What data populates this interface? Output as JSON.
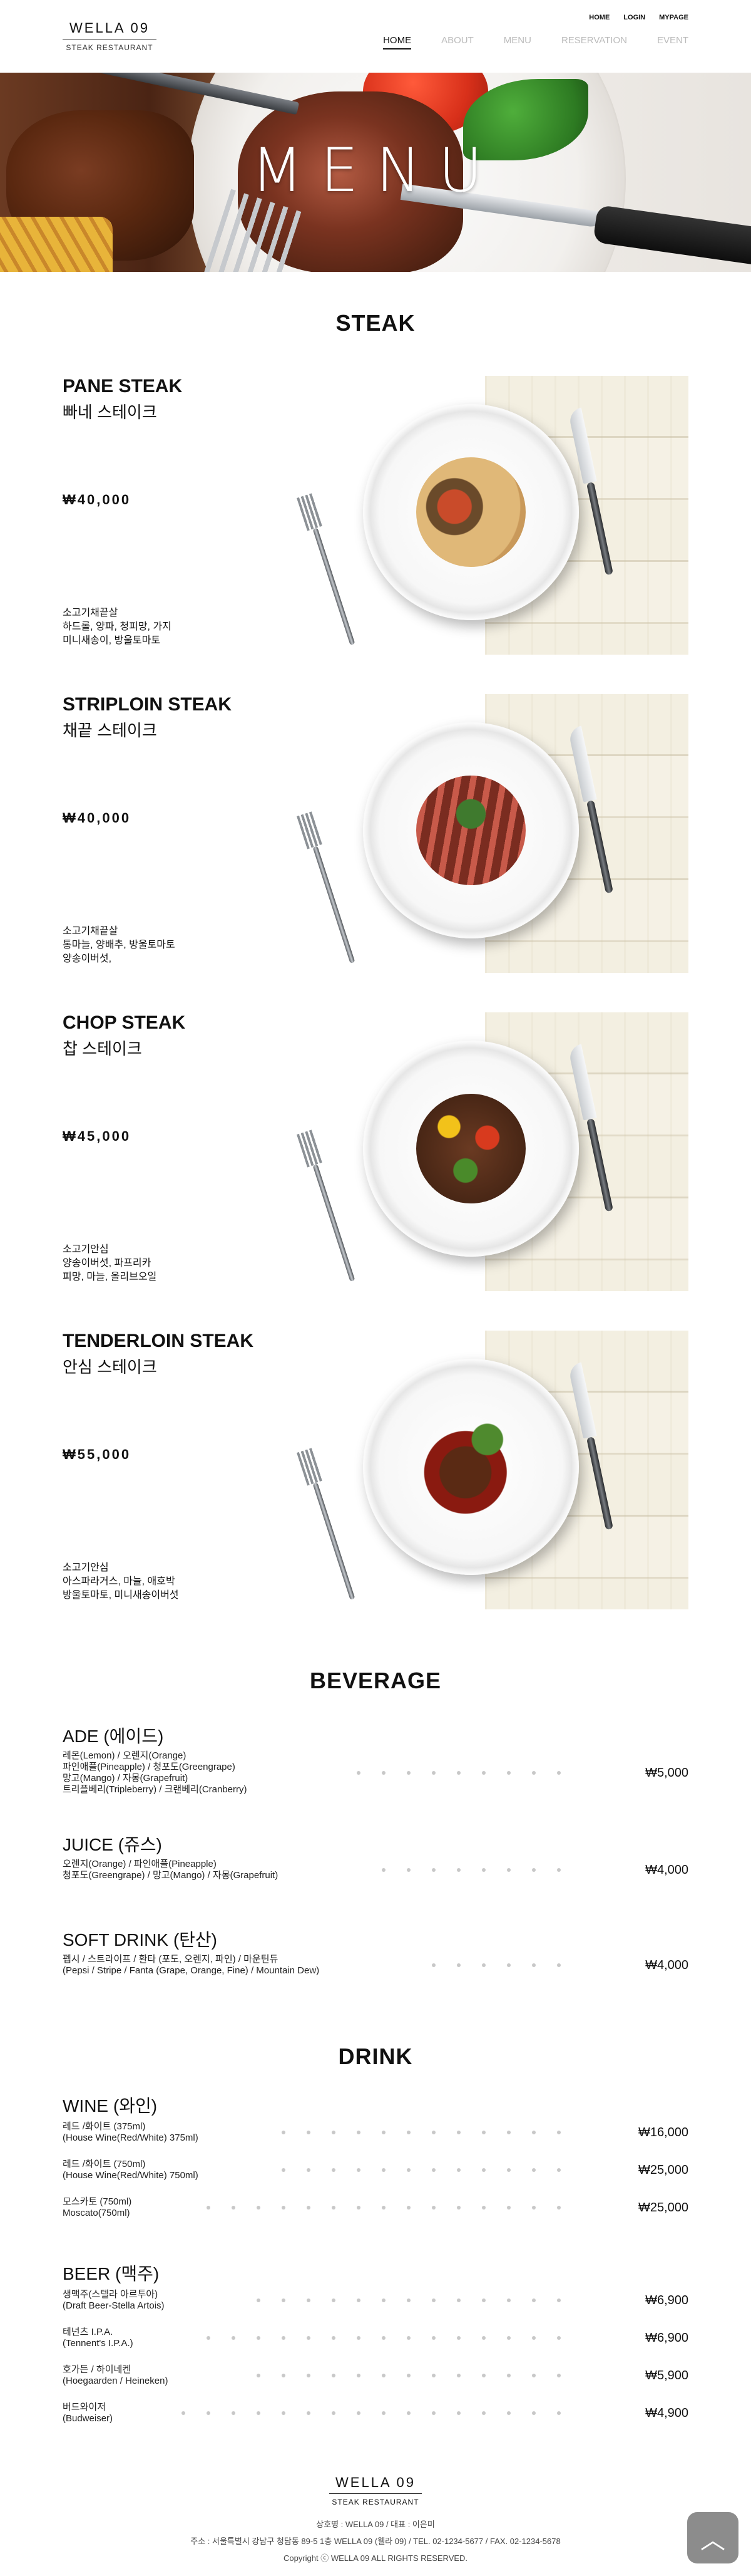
{
  "header": {
    "logo_name": "WELLA 09",
    "logo_sub": "STEAK RESTAURANT",
    "util": [
      "HOME",
      "LOGIN",
      "MYPAGE"
    ],
    "nav": [
      "HOME",
      "ABOUT",
      "MENU",
      "RESERVATION",
      "EVENT"
    ],
    "active_nav": "HOME"
  },
  "hero": {
    "title": "MENU"
  },
  "steak_section": {
    "title": "STEAK",
    "items": [
      {
        "name_en": "PANE STEAK",
        "name_ko": "빠네 스테이크",
        "price": "₩40,000",
        "desc": [
          "소고기채끝살",
          "하드롤, 양파, 청피망, 가지",
          "미니새송이, 방울토마토"
        ]
      },
      {
        "name_en": "STRIPLOIN STEAK",
        "name_ko": "채끝 스테이크",
        "price": "₩40,000",
        "desc": [
          "소고기채끝살",
          "통마늘, 양배추, 방울토마토",
          "양송이버섯,"
        ]
      },
      {
        "name_en": "CHOP STEAK",
        "name_ko": "찹 스테이크",
        "price": "₩45,000",
        "desc": [
          "소고기안심",
          "양송이버섯, 파프리카",
          "피망, 마늘, 올리브오일"
        ]
      },
      {
        "name_en": "TENDERLOIN STEAK",
        "name_ko": "안심 스테이크",
        "price": "₩55,000",
        "desc": [
          "소고기안심",
          "아스파라거스, 마늘, 애호박",
          "방울토마토, 미니새송이버섯"
        ]
      }
    ]
  },
  "beverage_section": {
    "title": "BEVERAGE",
    "groups": [
      {
        "title": "ADE (에이드)",
        "rows": [
          {
            "lines": [
              "레몬(Lemon) / 오렌지(Orange)",
              "파인애플(Pineapple) / 청포도(Greengrape)",
              "망고(Mango) / 자몽(Grapefruit)",
              "트리플베리(Tripleberry) / 크랜베리(Cranberry)"
            ],
            "price": "₩5,000"
          }
        ]
      },
      {
        "title": "JUICE (쥬스)",
        "rows": [
          {
            "lines": [
              "오렌지(Orange) / 파인애플(Pineapple)",
              "청포도(Greengrape) / 망고(Mango) / 자몽(Grapefruit)"
            ],
            "price": "₩4,000"
          }
        ]
      },
      {
        "title": "SOFT DRINK (탄산)",
        "rows": [
          {
            "lines": [
              "펩시 / 스트라이프 / 환타 (포도, 오렌지, 파인) / 마운틴듀",
              "(Pepsi / Stripe / Fanta (Grape, Orange, Fine) / Mountain Dew)"
            ],
            "price": "₩4,000"
          }
        ]
      }
    ]
  },
  "drink_section": {
    "title": "DRINK",
    "groups": [
      {
        "title": "WINE (와인)",
        "rows": [
          {
            "lines": [
              "레드 /화이트 (375ml)",
              "(House Wine(Red/White) 375ml)"
            ],
            "price": "₩16,000"
          },
          {
            "lines": [
              "레드 /화이트 (750ml)",
              "(House Wine(Red/White) 750ml)"
            ],
            "price": "₩25,000"
          },
          {
            "lines": [
              "모스카토 (750ml)",
              "Moscato(750ml)"
            ],
            "price": "₩25,000"
          }
        ]
      },
      {
        "title": "BEER (맥주)",
        "rows": [
          {
            "lines": [
              "생맥주(스텔라 아르투아)",
              "(Draft Beer-Stella Artois)"
            ],
            "price": "₩6,900"
          },
          {
            "lines": [
              "테넌츠 I.P.A.",
              "(Tennent's I.P.A.)"
            ],
            "price": "₩6,900"
          },
          {
            "lines": [
              "호가든 / 하이네켄",
              "(Hoegaarden / Heineken)"
            ],
            "price": "₩5,900"
          },
          {
            "lines": [
              "버드와이저",
              "(Budweiser)"
            ],
            "price": "₩4,900"
          }
        ]
      }
    ]
  },
  "footer": {
    "logo_name": "WELLA 09",
    "logo_sub": "STEAK RESTAURANT",
    "line1": "상호명 : WELLA 09   /   대표 : 이은미",
    "line2": "주소 : 서울특별시 강남구 청담동 89-5 1층 WELLA 09 (웰라 09)   /   TEL. 02-1234-5677   /   FAX. 02-1234-5678",
    "copyright": "Copyright ⓒ WELLA 09  ALL RIGHTS RESERVED."
  },
  "top_button": {
    "icon": "chevron-up-icon",
    "label": "︿"
  }
}
